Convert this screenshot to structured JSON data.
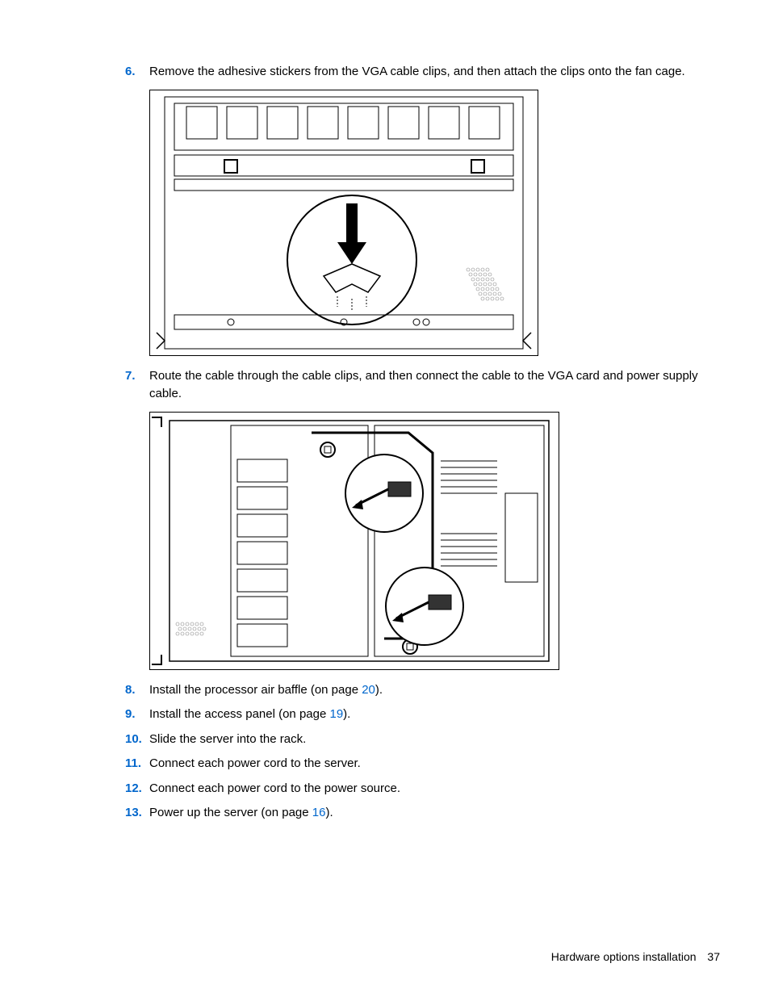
{
  "steps": [
    {
      "num": "6.",
      "text": "Remove the adhesive stickers from the VGA cable clips, and then attach the clips onto the fan cage."
    },
    {
      "num": "7.",
      "text": "Route the cable through the cable clips, and then connect the cable to the VGA card and power supply cable."
    },
    {
      "num": "8.",
      "prefix": "Install the processor air baffle (on page ",
      "link": "20",
      "suffix": ")."
    },
    {
      "num": "9.",
      "prefix": "Install the access panel (on page ",
      "link": "19",
      "suffix": ")."
    },
    {
      "num": "10.",
      "text": "Slide the server into the rack."
    },
    {
      "num": "11.",
      "text": "Connect each power cord to the server."
    },
    {
      "num": "12.",
      "text": "Connect each power cord to the power source."
    },
    {
      "num": "13.",
      "prefix": "Power up the server (on page ",
      "link": "16",
      "suffix": ")."
    }
  ],
  "footer": {
    "section": "Hardware options installation",
    "page": "37"
  }
}
